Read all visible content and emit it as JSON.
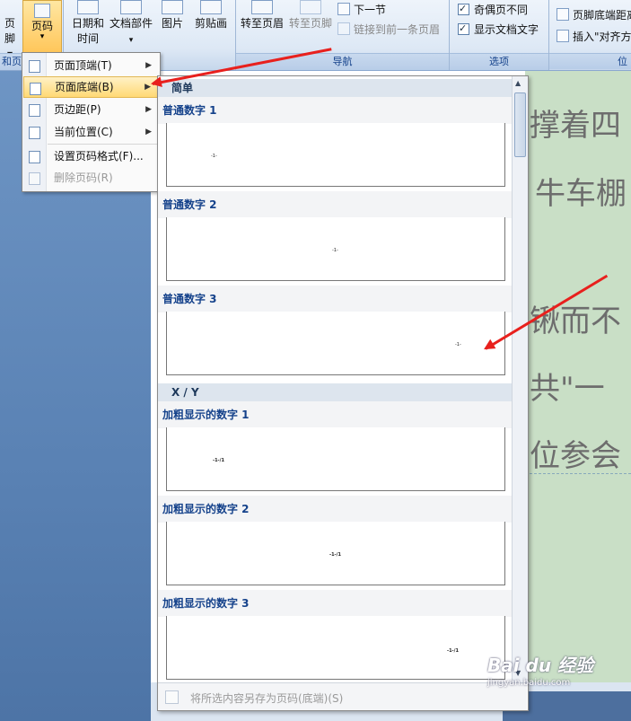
{
  "ribbon": {
    "left_cut_label": "页脚",
    "page_number_label": "页码",
    "header_footer_group": "和页",
    "buttons": [
      {
        "icon": "calendar-icon",
        "label1": "日期和",
        "label2": "时间"
      },
      {
        "icon": "document-parts-icon",
        "label1": "文档部件",
        "label2": "▾"
      },
      {
        "icon": "picture-icon",
        "label1": "图片",
        "label2": ""
      },
      {
        "icon": "clipart-icon",
        "label1": "剪贴画",
        "label2": ""
      }
    ],
    "nav": {
      "goto_header": "转至页眉",
      "goto_footer": "转至页脚",
      "next_section": "下一节",
      "link_previous": "链接到前一条页眉",
      "group_label": "导航"
    },
    "options": {
      "different_odd_even": "奇偶页不同",
      "show_doc_text": "显示文档文字",
      "group_label": "选项"
    },
    "position": {
      "footer_distance": "页脚底端距离",
      "insert_align": "插入\"对齐方",
      "group_label": "位"
    }
  },
  "menu": {
    "items": [
      {
        "label": "页面顶端(T)",
        "icon": "page-top-icon",
        "submenu": true,
        "active": false,
        "disabled": false
      },
      {
        "label": "页面底端(B)",
        "icon": "page-bottom-icon",
        "submenu": true,
        "active": true,
        "disabled": false
      },
      {
        "label": "页边距(P)",
        "icon": "page-margin-icon",
        "submenu": true,
        "active": false,
        "disabled": false
      },
      {
        "label": "当前位置(C)",
        "icon": "current-position-icon",
        "submenu": true,
        "active": false,
        "disabled": false
      },
      {
        "label": "设置页码格式(F)...",
        "icon": "format-page-number-icon",
        "submenu": false,
        "active": false,
        "disabled": false
      },
      {
        "label": "删除页码(R)",
        "icon": "remove-page-number-icon",
        "submenu": false,
        "active": false,
        "disabled": true
      }
    ]
  },
  "gallery": {
    "sections": [
      {
        "header": "简单",
        "items": [
          {
            "title": "普通数字 1",
            "sample": "-1-"
          },
          {
            "title": "普通数字 2",
            "sample": "-1-"
          },
          {
            "title": "普通数字 3",
            "sample": "-1-"
          }
        ]
      },
      {
        "header": "X / Y",
        "items": [
          {
            "title": "加粗显示的数字 1",
            "sample": "-1-/1"
          },
          {
            "title": "加粗显示的数字 2",
            "sample": "-1-/1"
          },
          {
            "title": "加粗显示的数字 3",
            "sample": "-1-/1"
          }
        ]
      }
    ],
    "footer": "将所选内容另存为页码(底端)(S)"
  },
  "document": {
    "lines": [
      "撑着四",
      "牛车棚",
      "锹而不",
      "共\"一",
      "位参会"
    ]
  },
  "watermark": {
    "logo": "Bai du 经验",
    "url": "jingyan.baidu.com"
  },
  "colors": {
    "accent_arrow": "#e8201d",
    "menu_highlight": "#ffd975",
    "section_header_bg": "#dde5ee",
    "title_blue": "#15428b"
  }
}
